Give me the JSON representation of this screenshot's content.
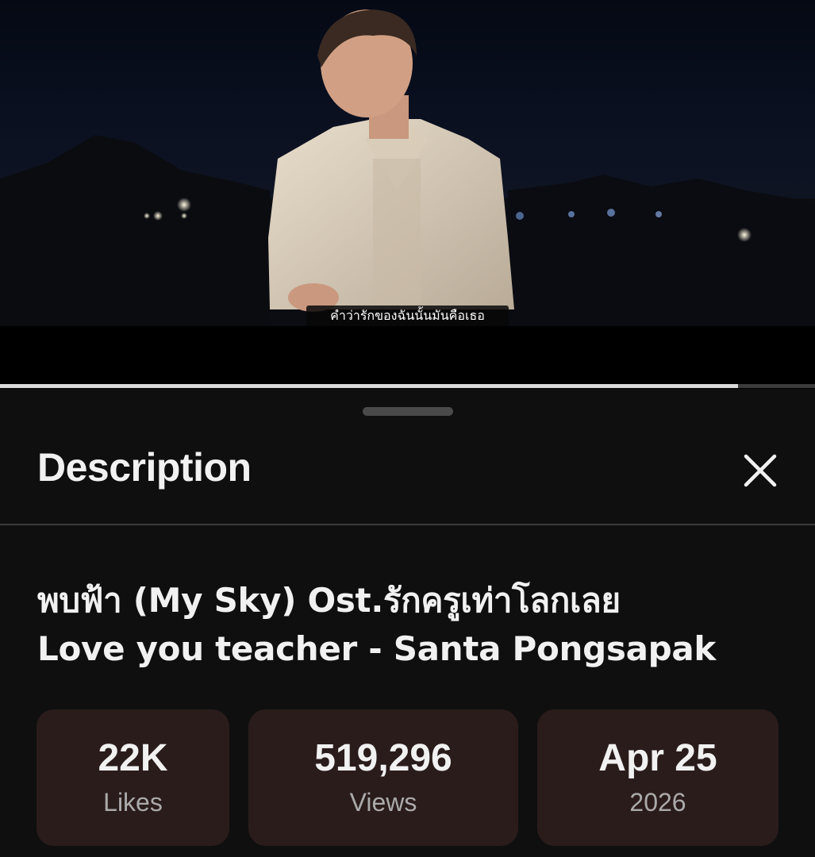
{
  "player": {
    "subtitle": "คำว่ารักของฉันนั้นมันคือเธอ",
    "progress_fraction": 0.906
  },
  "description_panel": {
    "title": "Description",
    "close_icon": "close-icon",
    "video_title_line1": "พบฟ้า (My Sky) Ost.รักครูเท่าโลกเลย",
    "video_title_line2": "Love you teacher - Santa Pongsapak",
    "stats": [
      {
        "value": "22K",
        "label": "Likes"
      },
      {
        "value": "519,296",
        "label": "Views"
      },
      {
        "value": "Apr 25",
        "label": "2026"
      }
    ]
  },
  "colors": {
    "background": "#0f0f0f",
    "stat_card": "#2b1c1c",
    "progress_fill": "#d9d9d9",
    "muted_text": "#aaaaaa"
  }
}
